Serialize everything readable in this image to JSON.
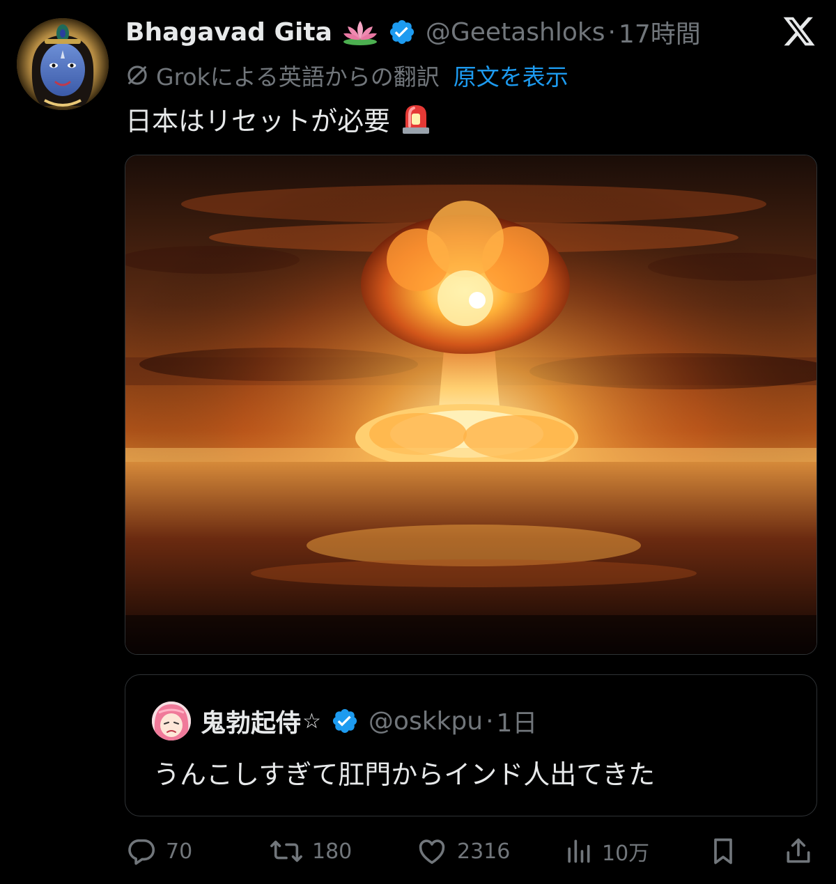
{
  "author": {
    "display_name": "Bhagavad Gita",
    "handle": "@Geetashloks",
    "separator": "·",
    "time": "17時間",
    "avatar_icon": "krishna-avatar",
    "badges": [
      "lotus-emoji",
      "verified-badge"
    ]
  },
  "translation": {
    "label": "Grokによる英語からの翻訳",
    "show_original": "原文を表示",
    "icon": "grok-icon"
  },
  "tweet": {
    "text": "日本はリセットが必要",
    "emoji": "rotating-light-siren"
  },
  "media": {
    "description_icon": "mushroom-cloud-image"
  },
  "quote": {
    "display_name": "鬼勃起侍",
    "star": "☆",
    "handle": "@oskkpu",
    "separator": "·",
    "time": "1日",
    "text": "うんこしすぎて肛門からインド人出てきた"
  },
  "actions": {
    "reply_count": "70",
    "retweet_count": "180",
    "like_count": "2316",
    "view_count": "10万"
  },
  "colors": {
    "background": "#000000",
    "text": "#e7e9ea",
    "secondary": "#71767b",
    "accent": "#1d9bf0",
    "border": "#2f3336"
  }
}
